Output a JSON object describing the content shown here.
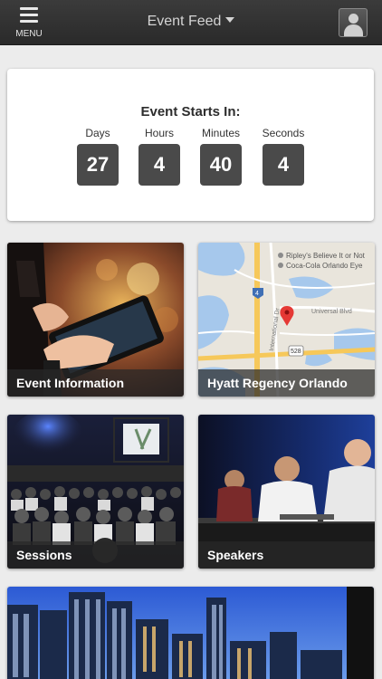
{
  "header": {
    "menu_label": "MENU",
    "feed_title": "Event Feed",
    "menu_icon": "hamburger-icon",
    "profile_icon": "user-silhouette-icon"
  },
  "countdown": {
    "title": "Event Starts In:",
    "units": [
      {
        "label": "Days",
        "value": "27"
      },
      {
        "label": "Hours",
        "value": "4"
      },
      {
        "label": "Minutes",
        "value": "40"
      },
      {
        "label": "Seconds",
        "value": "4"
      }
    ]
  },
  "tiles": [
    {
      "label": "Event Information"
    },
    {
      "label": "Hyatt Regency Orlando"
    },
    {
      "label": "Sessions"
    },
    {
      "label": "Speakers"
    }
  ],
  "map": {
    "place_1": "Ripley's Believe It or Not",
    "place_2": "Coca-Cola Orlando Eye",
    "road_1": "Universal Blvd",
    "road_2": "International Dr",
    "route_shield": "528",
    "shield_4": "4"
  },
  "colors": {
    "topbar": "#2f2f2f",
    "count_box": "#4a4a4a",
    "background": "#ececec",
    "map_pin": "#e53935"
  }
}
